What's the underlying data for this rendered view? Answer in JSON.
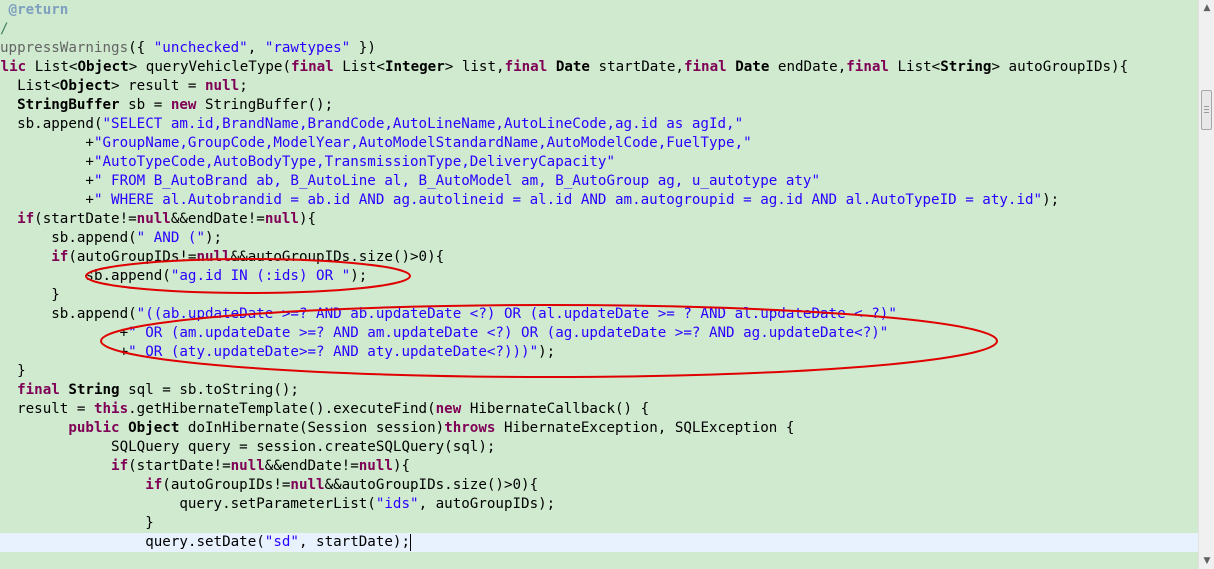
{
  "editor": {
    "lines": [
      [
        {
          "t": " @return",
          "c": "doc"
        }
      ],
      [
        {
          "t": "/",
          "c": "comment"
        }
      ],
      [
        {
          "t": "uppressWarnings",
          "c": "ann"
        },
        {
          "t": "({ ",
          "c": "pl"
        },
        {
          "t": "\"unchecked\"",
          "c": "str"
        },
        {
          "t": ", ",
          "c": "pl"
        },
        {
          "t": "\"rawtypes\"",
          "c": "str"
        },
        {
          "t": " })",
          "c": "pl"
        }
      ],
      [
        {
          "t": "blic ",
          "c": "kw"
        },
        {
          "t": "List<",
          "c": "pl"
        },
        {
          "t": "Object",
          "c": "ty"
        },
        {
          "t": "> ",
          "c": "pl"
        },
        {
          "t": "queryVehicleType",
          "c": "mth"
        },
        {
          "t": "(",
          "c": "pl"
        },
        {
          "t": "final ",
          "c": "kw"
        },
        {
          "t": "List<",
          "c": "pl"
        },
        {
          "t": "Integer",
          "c": "ty"
        },
        {
          "t": "> list,",
          "c": "pl"
        },
        {
          "t": "final ",
          "c": "kw"
        },
        {
          "t": "Date",
          "c": "ty"
        },
        {
          "t": " startDate,",
          "c": "pl"
        },
        {
          "t": "final ",
          "c": "kw"
        },
        {
          "t": "Date",
          "c": "ty"
        },
        {
          "t": " endDate,",
          "c": "pl"
        },
        {
          "t": "final ",
          "c": "kw"
        },
        {
          "t": "List<",
          "c": "pl"
        },
        {
          "t": "String",
          "c": "ty"
        },
        {
          "t": "> autoGroupIDs){",
          "c": "pl"
        }
      ],
      [
        {
          "t": "  List<",
          "c": "pl"
        },
        {
          "t": "Object",
          "c": "ty"
        },
        {
          "t": "> result = ",
          "c": "pl"
        },
        {
          "t": "null",
          "c": "kw"
        },
        {
          "t": ";",
          "c": "pl"
        }
      ],
      [
        {
          "t": "  StringBuffer",
          "c": "ty"
        },
        {
          "t": " sb = ",
          "c": "pl"
        },
        {
          "t": "new ",
          "c": "kw"
        },
        {
          "t": "StringBuffer();",
          "c": "pl"
        }
      ],
      [
        {
          "t": "  sb.append(",
          "c": "pl"
        },
        {
          "t": "\"SELECT am.id,BrandName,BrandCode,AutoLineName,AutoLineCode,ag.id as agId,\"",
          "c": "str"
        }
      ],
      [
        {
          "t": "          +",
          "c": "pl"
        },
        {
          "t": "\"GroupName,GroupCode,ModelYear,AutoModelStandardName,AutoModelCode,FuelType,\"",
          "c": "str"
        }
      ],
      [
        {
          "t": "          +",
          "c": "pl"
        },
        {
          "t": "\"AutoTypeCode,AutoBodyType,TransmissionType,DeliveryCapacity\"",
          "c": "str"
        }
      ],
      [
        {
          "t": "          +",
          "c": "pl"
        },
        {
          "t": "\" FROM B_AutoBrand ab, B_AutoLine al, B_AutoModel am, B_AutoGroup ag, u_autotype aty\"",
          "c": "str"
        }
      ],
      [
        {
          "t": "          +",
          "c": "pl"
        },
        {
          "t": "\" WHERE al.Autobrandid = ab.id AND ag.autolineid = al.id AND am.autogroupid = ag.id AND al.AutoTypeID = aty.id\"",
          "c": "str"
        },
        {
          "t": ");",
          "c": "pl"
        }
      ],
      [
        {
          "t": "  if",
          "c": "kw"
        },
        {
          "t": "(startDate!=",
          "c": "pl"
        },
        {
          "t": "null",
          "c": "kw"
        },
        {
          "t": "&&endDate!=",
          "c": "pl"
        },
        {
          "t": "null",
          "c": "kw"
        },
        {
          "t": "){",
          "c": "pl"
        }
      ],
      [
        {
          "t": "      sb.append(",
          "c": "pl"
        },
        {
          "t": "\" AND (\"",
          "c": "str"
        },
        {
          "t": ");",
          "c": "pl"
        }
      ],
      [
        {
          "t": "      if",
          "c": "kw"
        },
        {
          "t": "(autoGroupIDs!=",
          "c": "pl"
        },
        {
          "t": "null",
          "c": "kw"
        },
        {
          "t": "&&autoGroupIDs.size()>0){",
          "c": "pl"
        }
      ],
      [
        {
          "t": "          sb.append(",
          "c": "pl"
        },
        {
          "t": "\"ag.id IN (:ids) OR \"",
          "c": "str"
        },
        {
          "t": ");",
          "c": "pl"
        }
      ],
      [
        {
          "t": "      }",
          "c": "pl"
        }
      ],
      [
        {
          "t": "      sb.append(",
          "c": "pl"
        },
        {
          "t": "\"((ab.updateDate >=? AND ab.updateDate <?) OR (al.updateDate >= ? AND al.updateDate < ?)\"",
          "c": "str"
        }
      ],
      [
        {
          "t": "              +",
          "c": "pl"
        },
        {
          "t": "\" OR (am.updateDate >=? AND am.updateDate <?) OR (ag.updateDate >=? AND ag.updateDate<?)\"",
          "c": "str"
        }
      ],
      [
        {
          "t": "              +",
          "c": "pl"
        },
        {
          "t": "\" OR (aty.updateDate>=? AND aty.updateDate<?)))\"",
          "c": "str"
        },
        {
          "t": ");",
          "c": "pl"
        }
      ],
      [
        {
          "t": "  }",
          "c": "pl"
        }
      ],
      [
        {
          "t": "  final ",
          "c": "kw"
        },
        {
          "t": "String",
          "c": "ty"
        },
        {
          "t": " sql = sb.toString();",
          "c": "pl"
        }
      ],
      [
        {
          "t": "  result = ",
          "c": "pl"
        },
        {
          "t": "this",
          "c": "kw"
        },
        {
          "t": ".getHibernateTemplate().executeFind(",
          "c": "pl"
        },
        {
          "t": "new ",
          "c": "kw"
        },
        {
          "t": "HibernateCallback() {",
          "c": "pl"
        }
      ],
      [
        {
          "t": "        public ",
          "c": "kw"
        },
        {
          "t": "Object",
          "c": "ty"
        },
        {
          "t": " doInHibernate",
          "c": "mth"
        },
        {
          "t": "(Session session)",
          "c": "pl"
        },
        {
          "t": "throws ",
          "c": "kw"
        },
        {
          "t": "HibernateException, SQLException {",
          "c": "pl"
        }
      ],
      [
        {
          "t": "             SQLQuery query = session.createSQLQuery(sql);",
          "c": "pl"
        }
      ],
      [
        {
          "t": "             if",
          "c": "kw"
        },
        {
          "t": "(startDate!=",
          "c": "pl"
        },
        {
          "t": "null",
          "c": "kw"
        },
        {
          "t": "&&endDate!=",
          "c": "pl"
        },
        {
          "t": "null",
          "c": "kw"
        },
        {
          "t": "){",
          "c": "pl"
        }
      ],
      [
        {
          "t": "                 if",
          "c": "kw"
        },
        {
          "t": "(autoGroupIDs!=",
          "c": "pl"
        },
        {
          "t": "null",
          "c": "kw"
        },
        {
          "t": "&&autoGroupIDs.size()>0){",
          "c": "pl"
        }
      ],
      [
        {
          "t": "                     query.setParameterList(",
          "c": "pl"
        },
        {
          "t": "\"ids\"",
          "c": "str"
        },
        {
          "t": ", autoGroupIDs);",
          "c": "pl"
        }
      ],
      [
        {
          "t": "                 }",
          "c": "pl"
        }
      ],
      [
        {
          "t": "                 query.setDate(",
          "c": "pl"
        },
        {
          "t": "\"sd\"",
          "c": "str"
        },
        {
          "t": ", startDate);",
          "c": "pl"
        }
      ]
    ]
  },
  "colors": {
    "editor_bg": "#cfeacf",
    "current_line_bg": "#e8f2fe",
    "annotation_stroke": "#e00000"
  },
  "scrollbar": {
    "up_icon": "scroll-up-arrow-icon",
    "down_icon": "scroll-down-arrow-icon"
  }
}
